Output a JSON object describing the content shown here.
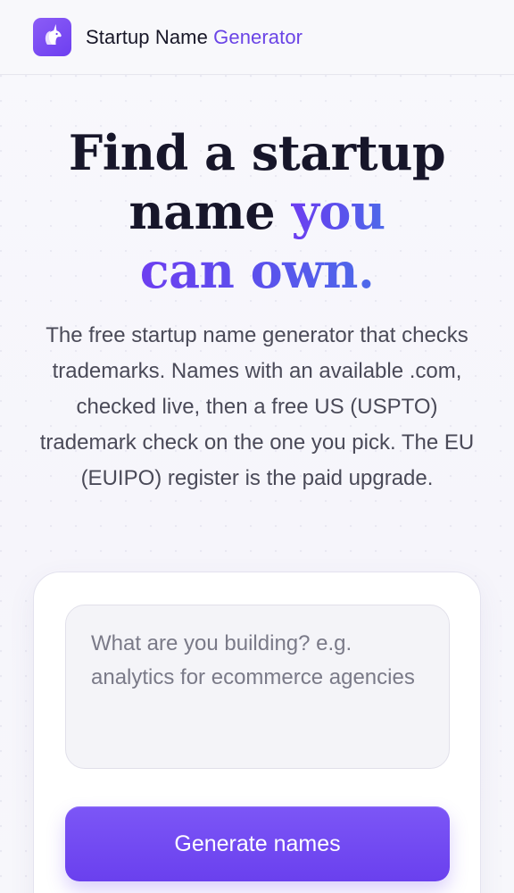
{
  "header": {
    "brand_name": "Startup Name",
    "brand_accent": "Generator",
    "logo_icon": "unicorn-icon"
  },
  "hero": {
    "title_line1": "Find a startup",
    "title_line2_plain": "name",
    "title_line2_accent": "you",
    "title_line3_accent": "can own.",
    "subtitle": "The free startup name generator that checks trademarks. Names with an available .com, checked live, then a free US (USPTO) trademark check on the one you pick. The EU (EUIPO) register is the paid upgrade."
  },
  "form": {
    "input_value": "",
    "input_placeholder": "What are you building? e.g. analytics for ecommerce agencies",
    "generate_label": "Generate names"
  },
  "colors": {
    "accent": "#6a44e6",
    "button": "#7048f0",
    "title": "#17162a"
  }
}
